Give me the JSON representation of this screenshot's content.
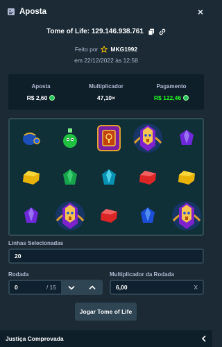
{
  "header": {
    "title": "Aposta",
    "icon": "bet-slip-icon",
    "close_icon": "close-icon",
    "close_symbol": "×"
  },
  "game": {
    "id_text": "Tome of Life: 129.146.938.761",
    "copy_icon": "copy-icon",
    "link_icon": "link-icon"
  },
  "meta": {
    "made_by_label": "Feito por",
    "star_icon": "star-icon",
    "username": "MKG1992",
    "date_text": "em 22/12/2022 às 12:58"
  },
  "stats": {
    "bet": {
      "label": "Aposta",
      "value": "R$ 2,60"
    },
    "multiplier": {
      "label": "Multiplicador",
      "value": "47,10×"
    },
    "payout": {
      "label": "Pagamento",
      "value": "R$ 122,46"
    }
  },
  "reels": {
    "rows": [
      [
        "scarab",
        "green-potion",
        "tome-of-life",
        "pharaoh",
        "purple-gem"
      ],
      [
        "yellow-gem",
        "green-gem",
        "cyan-gem",
        "red-gem",
        "yellow-gem"
      ],
      [
        "purple-gem",
        "pharaoh",
        "red-gem",
        "blue-gem",
        "pharaoh"
      ]
    ]
  },
  "lines": {
    "label": "Linhas Selecionadas",
    "value": "20"
  },
  "round": {
    "label": "Rodada",
    "value": "0",
    "total": "/ 15"
  },
  "round_multiplier": {
    "label": "Multiplicador da Rodada",
    "value": "6,00",
    "suffix": "X"
  },
  "action": {
    "label": "Jogar Tome of Life"
  },
  "footer": {
    "label": "Justiça Comprovada",
    "chevron_icon": "chevron-left-icon"
  },
  "colors": {
    "background": "#1b2a35",
    "panel": "#0f1f2a",
    "accent_green": "#1fff20",
    "button": "#2f4553",
    "muted_text": "#b1bad3"
  }
}
